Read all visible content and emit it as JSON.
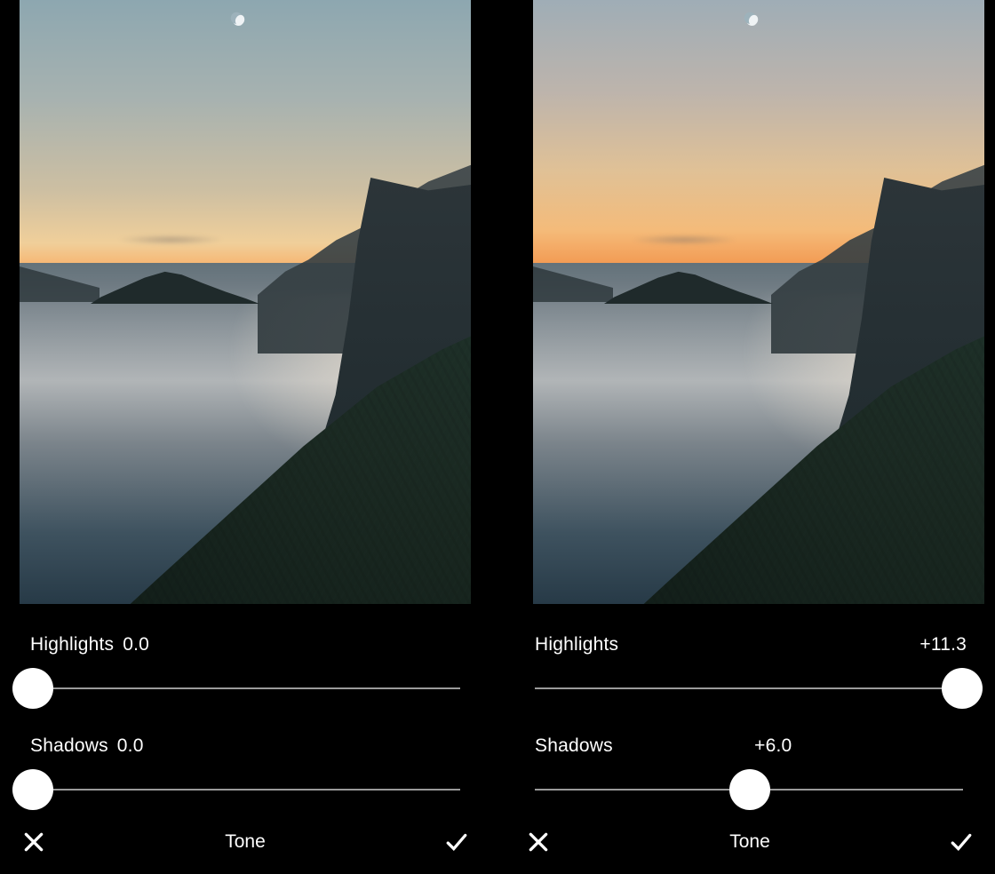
{
  "panels": [
    {
      "highlights": {
        "label": "Highlights",
        "value": "0.0",
        "position_percent": 3
      },
      "shadows": {
        "label": "Shadows",
        "value": "0.0",
        "position_percent": 3
      },
      "title": "Tone"
    },
    {
      "highlights": {
        "label": "Highlights",
        "value": "+11.3",
        "position_percent": 97
      },
      "shadows": {
        "label": "Shadows",
        "value": "+6.0",
        "position_percent": 50
      },
      "title": "Tone"
    }
  ],
  "icons": {
    "cancel": "close-icon",
    "confirm": "check-icon"
  }
}
